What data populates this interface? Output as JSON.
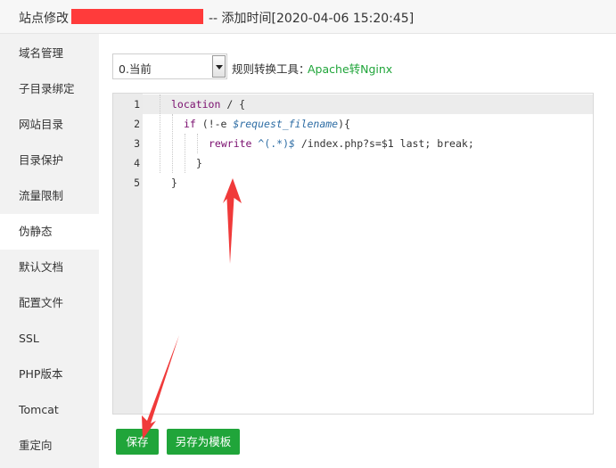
{
  "header": {
    "title_prefix": "站点修改",
    "title_suffix": "-- 添加时间[2020-04-06 15:20:45]"
  },
  "sidebar": {
    "items": [
      {
        "label": "域名管理"
      },
      {
        "label": "子目录绑定"
      },
      {
        "label": "网站目录"
      },
      {
        "label": "目录保护"
      },
      {
        "label": "流量限制"
      },
      {
        "label": "伪静态",
        "active": true
      },
      {
        "label": "默认文档"
      },
      {
        "label": "配置文件"
      },
      {
        "label": "SSL"
      },
      {
        "label": "PHP版本"
      },
      {
        "label": "Tomcat"
      },
      {
        "label": "重定向"
      }
    ]
  },
  "toolbar": {
    "template_select_value": "0.当前",
    "tool_label": "规则转换工具：",
    "tool_link": "Apache转Nginx"
  },
  "editor": {
    "line_numbers": [
      "1",
      "2",
      "3",
      "4",
      "5"
    ],
    "lines": [
      {
        "kw": "location",
        "rest": " / {"
      },
      {
        "kw": "if",
        "mid": " (!-e ",
        "var": "$request_filename",
        "rest": "){"
      },
      {
        "kw": "rewrite",
        "mid": " ^(.*)",
        "var": "$",
        "rest": " /index.php?s=$1 last; break;"
      },
      {
        "rest": "}"
      },
      {
        "rest": "}"
      }
    ]
  },
  "actions": {
    "save_label": "保存",
    "save_as_template_label": "另存为模板"
  },
  "colors": {
    "accent_green": "#20a53a",
    "annotation_red": "#f03a3a",
    "redaction_red": "#ff3b3b"
  }
}
